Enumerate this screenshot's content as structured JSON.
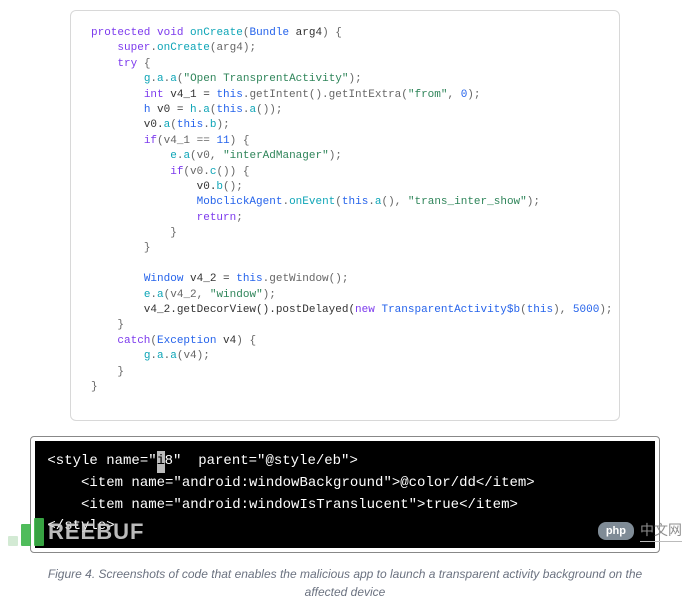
{
  "caption": "Figure 4. Screenshots of code that enables the malicious app to launch a transparent activity background on the affected device",
  "java_code": {
    "tokens": [
      [
        [
          "k",
          "protected"
        ],
        [
          "id",
          " "
        ],
        [
          "k",
          "void"
        ],
        [
          "id",
          " "
        ],
        [
          "fn",
          "onCreate"
        ],
        [
          "punc",
          "("
        ],
        [
          "ty",
          "Bundle"
        ],
        [
          "id",
          " arg4"
        ],
        [
          "punc",
          ") {"
        ]
      ],
      [
        [
          "id",
          "    "
        ],
        [
          "k",
          "super"
        ],
        [
          "punc",
          "."
        ],
        [
          "fn",
          "onCreate"
        ],
        [
          "punc",
          "(arg4);"
        ]
      ],
      [
        [
          "id",
          "    "
        ],
        [
          "k",
          "try"
        ],
        [
          "id",
          " "
        ],
        [
          "punc",
          "{"
        ]
      ],
      [
        [
          "id",
          "        "
        ],
        [
          "fn",
          "g"
        ],
        [
          "punc",
          "."
        ],
        [
          "fn",
          "a"
        ],
        [
          "punc",
          "."
        ],
        [
          "fn",
          "a"
        ],
        [
          "punc",
          "("
        ],
        [
          "str",
          "\"Open TransprentActivity\""
        ],
        [
          "punc",
          ");"
        ]
      ],
      [
        [
          "id",
          "        "
        ],
        [
          "k",
          "int"
        ],
        [
          "id",
          " v4_1 = "
        ],
        [
          "this",
          "this"
        ],
        [
          "punc",
          ".getIntent().getIntExtra("
        ],
        [
          "str",
          "\"from\""
        ],
        [
          "punc",
          ", "
        ],
        [
          "num",
          "0"
        ],
        [
          "punc",
          ");"
        ]
      ],
      [
        [
          "id",
          "        "
        ],
        [
          "ty",
          "h"
        ],
        [
          "id",
          " v0 = "
        ],
        [
          "fn",
          "h"
        ],
        [
          "punc",
          "."
        ],
        [
          "fn",
          "a"
        ],
        [
          "punc",
          "("
        ],
        [
          "this",
          "this"
        ],
        [
          "punc",
          "."
        ],
        [
          "fn",
          "a"
        ],
        [
          "punc",
          "());"
        ]
      ],
      [
        [
          "id",
          "        v0."
        ],
        [
          "fn",
          "a"
        ],
        [
          "punc",
          "("
        ],
        [
          "this",
          "this"
        ],
        [
          "punc",
          "."
        ],
        [
          "fn",
          "b"
        ],
        [
          "punc",
          ");"
        ]
      ],
      [
        [
          "id",
          "        "
        ],
        [
          "k",
          "if"
        ],
        [
          "punc",
          "(v4_1 == "
        ],
        [
          "num",
          "11"
        ],
        [
          "punc",
          ") {"
        ]
      ],
      [
        [
          "id",
          "            "
        ],
        [
          "fn",
          "e"
        ],
        [
          "punc",
          "."
        ],
        [
          "fn",
          "a"
        ],
        [
          "punc",
          "(v0, "
        ],
        [
          "str",
          "\"interAdManager\""
        ],
        [
          "punc",
          ");"
        ]
      ],
      [
        [
          "id",
          "            "
        ],
        [
          "k",
          "if"
        ],
        [
          "punc",
          "(v0."
        ],
        [
          "fn",
          "c"
        ],
        [
          "punc",
          "()) {"
        ]
      ],
      [
        [
          "id",
          "                v0."
        ],
        [
          "fn",
          "b"
        ],
        [
          "punc",
          "();"
        ]
      ],
      [
        [
          "id",
          "                "
        ],
        [
          "ty",
          "MobclickAgent"
        ],
        [
          "punc",
          "."
        ],
        [
          "fn",
          "onEvent"
        ],
        [
          "punc",
          "("
        ],
        [
          "this",
          "this"
        ],
        [
          "punc",
          "."
        ],
        [
          "fn",
          "a"
        ],
        [
          "punc",
          "(), "
        ],
        [
          "str",
          "\"trans_inter_show\""
        ],
        [
          "punc",
          ");"
        ]
      ],
      [
        [
          "id",
          "                "
        ],
        [
          "k",
          "return"
        ],
        [
          "punc",
          ";"
        ]
      ],
      [
        [
          "id",
          "            "
        ],
        [
          "punc",
          "}"
        ]
      ],
      [
        [
          "id",
          "        "
        ],
        [
          "punc",
          "}"
        ]
      ],
      [
        [
          "id",
          ""
        ]
      ],
      [
        [
          "id",
          "        "
        ],
        [
          "ty",
          "Window"
        ],
        [
          "id",
          " v4_2 = "
        ],
        [
          "this",
          "this"
        ],
        [
          "punc",
          ".getWindow();"
        ]
      ],
      [
        [
          "id",
          "        "
        ],
        [
          "fn",
          "e"
        ],
        [
          "punc",
          "."
        ],
        [
          "fn",
          "a"
        ],
        [
          "punc",
          "(v4_2, "
        ],
        [
          "str",
          "\"window\""
        ],
        [
          "punc",
          ");"
        ]
      ],
      [
        [
          "id",
          "        v4_2.getDecorView().postDelayed("
        ],
        [
          "k",
          "new"
        ],
        [
          "id",
          " "
        ],
        [
          "ty",
          "TransparentActivity$b"
        ],
        [
          "punc",
          "("
        ],
        [
          "this",
          "this"
        ],
        [
          "punc",
          "), "
        ],
        [
          "num",
          "5000"
        ],
        [
          "punc",
          ");"
        ]
      ],
      [
        [
          "id",
          "    "
        ],
        [
          "punc",
          "}"
        ]
      ],
      [
        [
          "id",
          "    "
        ],
        [
          "k",
          "catch"
        ],
        [
          "punc",
          "("
        ],
        [
          "ty",
          "Exception"
        ],
        [
          "id",
          " v4"
        ],
        [
          "punc",
          ") {"
        ]
      ],
      [
        [
          "id",
          "        "
        ],
        [
          "fn",
          "g"
        ],
        [
          "punc",
          "."
        ],
        [
          "fn",
          "a"
        ],
        [
          "punc",
          "."
        ],
        [
          "fn",
          "a"
        ],
        [
          "punc",
          "(v4);"
        ]
      ],
      [
        [
          "id",
          "    "
        ],
        [
          "punc",
          "}"
        ]
      ],
      [
        [
          "punc",
          "}"
        ]
      ]
    ]
  },
  "xml_code": {
    "lines": [
      {
        "prefix": " <style name=\"",
        "cursor": "i",
        "suffix": "8\"  parent=\"@style/eb\">"
      },
      {
        "text": "     <item name=\"android:windowBackground\">@color/dd</item>"
      },
      {
        "text": "     <item name=\"android:windowIsTranslucent\">true</item>"
      },
      {
        "text": " </style>"
      }
    ]
  },
  "watermark_left": "REEBUF",
  "watermark_right_badge": "php",
  "watermark_right_text": "中文网"
}
